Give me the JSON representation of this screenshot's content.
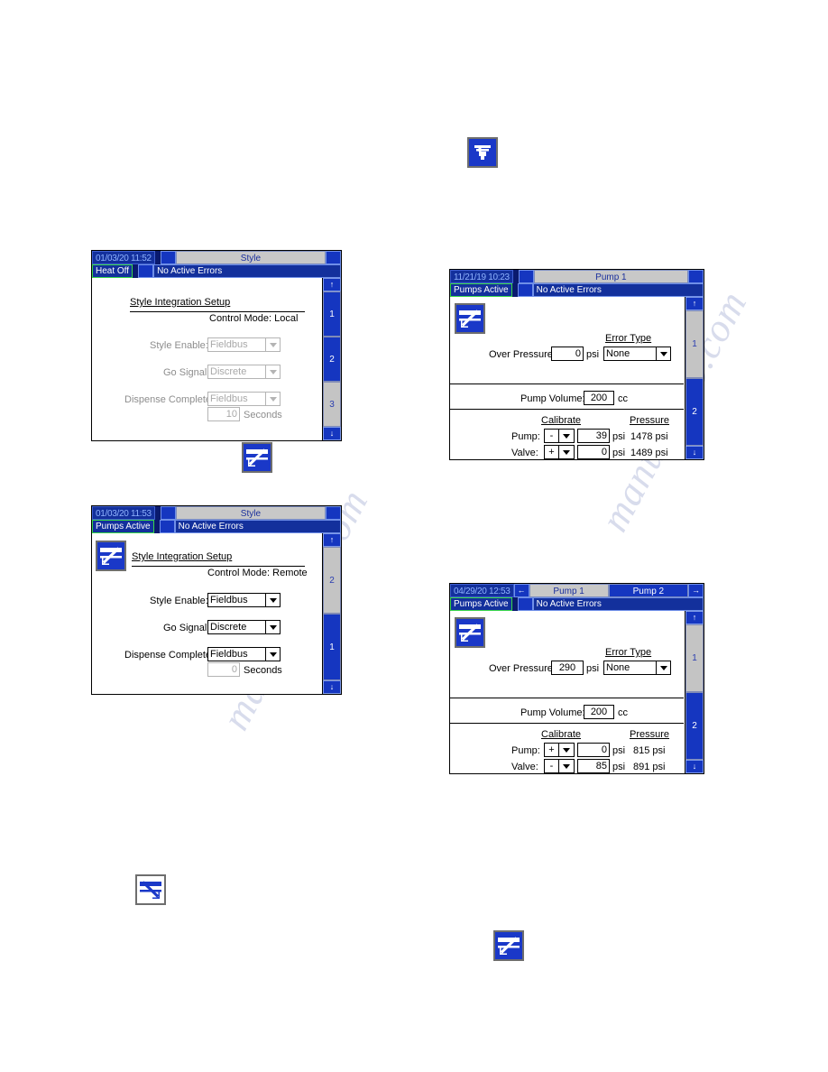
{
  "page": {
    "watermark": "manualslib.com"
  },
  "icons": {
    "applicator": {
      "name": "applicator-icon",
      "style": "filled"
    },
    "integration_filled": {
      "name": "integration-setup-icon",
      "style": "filled"
    },
    "integration_outline": {
      "name": "integration-setup-icon-outline",
      "style": "outline"
    }
  },
  "panels": [
    {
      "id": "style-local",
      "titlebar": {
        "clock": "01/03/20 11:52",
        "tabs": [
          {
            "label": "Style",
            "state": "active"
          }
        ],
        "left_arrow": "",
        "right_arrow": ""
      },
      "status": {
        "state": "Heat Off",
        "error": "No Active Errors"
      },
      "heading": "Style Integration Setup",
      "control_mode": "Control Mode: Local",
      "rows": [
        {
          "label": "Style Enable:",
          "value": "Fieldbus",
          "enabled": false
        },
        {
          "label": "Go Signal:",
          "value": "Discrete",
          "enabled": false
        },
        {
          "label": "Dispense Complete:",
          "value": "Fieldbus",
          "enabled": false
        }
      ],
      "seconds": {
        "value": "10",
        "unit": "Seconds",
        "enabled": false
      },
      "nav": {
        "up": "↑",
        "down": "↓",
        "pages": [
          {
            "label": "1",
            "selected": false
          },
          {
            "label": "2",
            "selected": false
          },
          {
            "label": "3",
            "selected": true
          }
        ]
      },
      "has_icon": false
    },
    {
      "id": "style-remote",
      "titlebar": {
        "clock": "01/03/20 11:53",
        "tabs": [
          {
            "label": "Style",
            "state": "active"
          }
        ],
        "left_arrow": "",
        "right_arrow": ""
      },
      "status": {
        "state": "Pumps Active",
        "error": "No Active Errors"
      },
      "heading": "Style Integration Setup",
      "control_mode": "Control Mode: Remote",
      "rows": [
        {
          "label": "Style Enable:",
          "value": "Fieldbus",
          "enabled": true
        },
        {
          "label": "Go Signal:",
          "value": "Discrete",
          "enabled": true
        },
        {
          "label": "Dispense Complete:",
          "value": "Fieldbus",
          "enabled": true
        }
      ],
      "seconds": {
        "value": "0",
        "unit": "Seconds",
        "enabled": false
      },
      "nav": {
        "up": "↑",
        "down": "↓",
        "pages": [
          {
            "label": "2",
            "selected": true
          },
          {
            "label": "1",
            "selected": false
          }
        ]
      },
      "has_icon": true
    },
    {
      "id": "pump1-view",
      "titlebar": {
        "clock": "11/21/19 10:23",
        "tabs": [
          {
            "label": "Pump 1",
            "state": "active"
          }
        ],
        "left_arrow": "",
        "right_arrow": ""
      },
      "status": {
        "state": "Pumps Active",
        "error": "No Active Errors"
      },
      "over_pressure": {
        "label": "Over Pressure:",
        "value": "0",
        "unit": "psi"
      },
      "error_type": {
        "label": "Error Type",
        "value": "None"
      },
      "pump_volume": {
        "label": "Pump Volume:",
        "value": "200",
        "unit": "cc"
      },
      "calibrate_header": "Calibrate",
      "pressure_header": "Pressure",
      "calibrate_rows": [
        {
          "label": "Pump:",
          "sign": "-",
          "value": "39",
          "unit": "psi",
          "pressure": "1478 psi"
        },
        {
          "label": "Valve:",
          "sign": "+",
          "value": "0",
          "unit": "psi",
          "pressure": "1489 psi"
        }
      ],
      "nav": {
        "up": "↑",
        "down": "↓",
        "pages": [
          {
            "label": "1",
            "selected": true
          },
          {
            "label": "2",
            "selected": false
          }
        ]
      },
      "has_icon": true
    },
    {
      "id": "pump1-edit",
      "titlebar": {
        "clock": "04/29/20 12:53",
        "tabs": [
          {
            "label": "Pump 1",
            "state": "active"
          },
          {
            "label": "Pump 2",
            "state": "inactive"
          }
        ],
        "left_arrow": "←",
        "right_arrow": "→"
      },
      "status": {
        "state": "Pumps Active",
        "error": "No Active Errors"
      },
      "over_pressure": {
        "label": "Over Pressure:",
        "value": "290",
        "unit": "psi"
      },
      "error_type": {
        "label": "Error Type",
        "value": "None"
      },
      "pump_volume": {
        "label": "Pump Volume:",
        "value": "200",
        "unit": "cc"
      },
      "calibrate_header": "Calibrate",
      "pressure_header": "Pressure",
      "calibrate_rows": [
        {
          "label": "Pump:",
          "sign": "+",
          "value": "0",
          "unit": "psi",
          "pressure": "815 psi"
        },
        {
          "label": "Valve:",
          "sign": "-",
          "value": "85",
          "unit": "psi",
          "pressure": "891 psi"
        }
      ],
      "nav": {
        "up": "↑",
        "down": "↓",
        "pages": [
          {
            "label": "1",
            "selected": true
          },
          {
            "label": "2",
            "selected": false
          }
        ]
      },
      "has_icon": true
    }
  ]
}
